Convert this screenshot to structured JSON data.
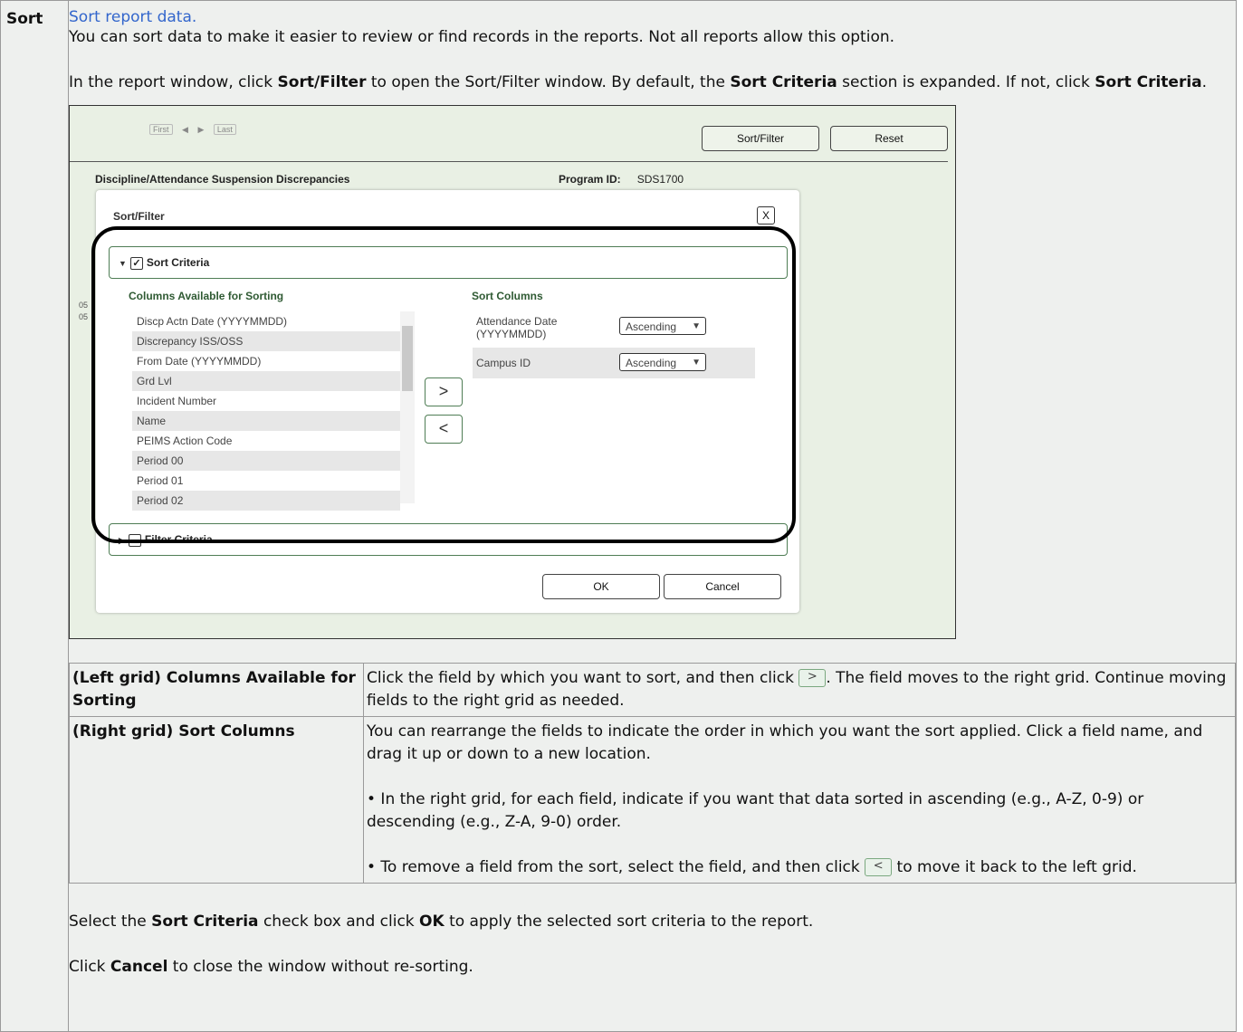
{
  "sort": {
    "label": "Sort",
    "link_text": "Sort report data.",
    "para1": "You can sort data to make it easier to review or find records in the reports. Not all reports allow this option.",
    "para2_a": "In the report window, click ",
    "para2_b": "Sort/Filter",
    "para2_c": " to open the Sort/Filter window. By default, the ",
    "para2_d": "Sort Criteria",
    "para2_e": " section is expanded. If not, click ",
    "para2_f": "Sort Criteria",
    "para2_g": "."
  },
  "screenshot": {
    "pager": [
      "First",
      "◀",
      "▶",
      "Last"
    ],
    "sort_filter_btn": "Sort/Filter",
    "reset_btn": "Reset",
    "report_title": "Discipline/Attendance Suspension Discrepancies",
    "program_id_label": "Program ID:",
    "program_id": "SDS1700",
    "left_marks": [
      "05",
      "05"
    ],
    "modal": {
      "title": "Sort/Filter",
      "close": "X",
      "sort_criteria": "Sort Criteria",
      "filter_criteria": "Filter Criteria",
      "available_header": "Columns Available for Sorting",
      "sort_columns_header": "Sort Columns",
      "available": [
        "Discp Actn Date (YYYYMMDD)",
        "Discrepancy ISS/OSS",
        "From Date (YYYYMMDD)",
        "Grd Lvl",
        "Incident Number",
        "Name",
        "PEIMS Action Code",
        "Period 00",
        "Period 01",
        "Period 02"
      ],
      "sort_rows": [
        {
          "name": "Attendance Date (YYYYMMDD)",
          "order": "Ascending"
        },
        {
          "name": "Campus ID",
          "order": "Ascending"
        }
      ],
      "move_right": ">",
      "move_left": "<",
      "ok": "OK",
      "cancel": "Cancel"
    }
  },
  "table": {
    "row1_key": "(Left grid) Columns Available for Sorting",
    "row1_a": "Click the field by which you want to sort, and then click ",
    "row1_btn": ">",
    "row1_b": ". The field moves to the right grid. Continue moving fields to the right grid as needed.",
    "row2_key": "(Right grid) Sort Columns",
    "row2_p1": "You can rearrange the fields to indicate the order in which you want the sort applied. Click a field name, and drag it up or down to a new location.",
    "row2_p2": "• In the right grid, for each field, indicate if you want that data sorted in ascending (e.g., A-Z, 0-9) or descending (e.g., Z-A, 9-0) order.",
    "row2_p3_a": "• To remove a field from the sort, select the field, and then click ",
    "row2_btn": "<",
    "row2_p3_b": " to move it back to the left grid."
  },
  "footer": {
    "p1_a": "Select the ",
    "p1_b": "Sort Criteria",
    "p1_c": " check box and click ",
    "p1_d": "OK",
    "p1_e": " to apply the selected sort criteria to the report.",
    "p2_a": "Click ",
    "p2_b": "Cancel",
    "p2_c": " to close the window without re-sorting."
  }
}
